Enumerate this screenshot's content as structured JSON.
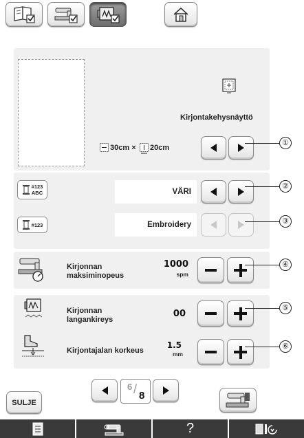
{
  "frame_display": {
    "label": "Kirjontakehysnäyttö",
    "width": "30cm ×",
    "height": "20cm"
  },
  "thread_color_display": {
    "value": "VÄRI",
    "icon_number": "#123",
    "icon_text": "ABC"
  },
  "thread_number_display": {
    "value": "Embroidery",
    "icon_number": "#123"
  },
  "max_speed": {
    "label_line1": "Kirjonnan",
    "label_line2": "maksiminopeus",
    "value": "1000",
    "unit": "spm"
  },
  "tension": {
    "label_line1": "Kirjonnan",
    "label_line2": "langankireys",
    "value": "00"
  },
  "foot_height": {
    "label": "Kirjontajalan korkeus",
    "value": "1.5",
    "unit": "mm"
  },
  "pagination": {
    "current": "6",
    "total": "8"
  },
  "close_button": "SULJE",
  "bottom_tabs": {
    "help": "?"
  },
  "callouts": [
    "①",
    "②",
    "③",
    "④",
    "⑤",
    "⑥"
  ]
}
